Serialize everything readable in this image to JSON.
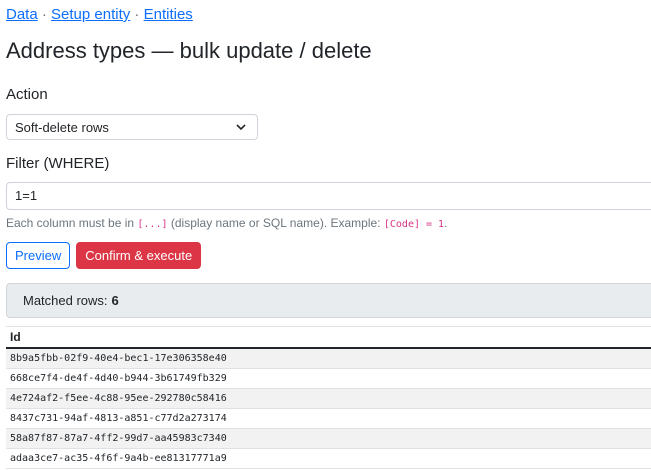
{
  "breadcrumb": {
    "items": [
      "Data",
      "Setup entity",
      "Entities"
    ],
    "separator": "·"
  },
  "page_title": "Address types — bulk update / delete",
  "action": {
    "label": "Action",
    "selected": "Soft-delete rows"
  },
  "filter": {
    "label": "Filter (WHERE)",
    "value": "1=1",
    "help_pre": "Each column must be in",
    "help_code1": "[...]",
    "help_mid": "(display name or SQL name). Example:",
    "help_code2": "[Code] = 1",
    "help_end": "."
  },
  "buttons": {
    "preview": "Preview",
    "confirm": "Confirm & execute"
  },
  "matched": {
    "label": "Matched rows:",
    "count": "6"
  },
  "table": {
    "header": "Id",
    "rows": [
      "8b9a5fbb-02f9-40e4-bec1-17e306358e40",
      "668ce7f4-de4f-4d40-b944-3b61749fb329",
      "4e724af2-f5ee-4c88-95ee-292780c58416",
      "8437c731-94af-4813-a851-c77d2a273174",
      "58a87f87-87a7-4ff2-99d7-aa45983c7340",
      "adaa3ce7-ac35-4f6f-9a4b-ee81317771a9"
    ]
  },
  "colors": {
    "link": "#0d6efd",
    "danger": "#dc3545",
    "code": "#d63384"
  },
  "icons": {
    "select_chevron": "chevron-down-icon"
  }
}
